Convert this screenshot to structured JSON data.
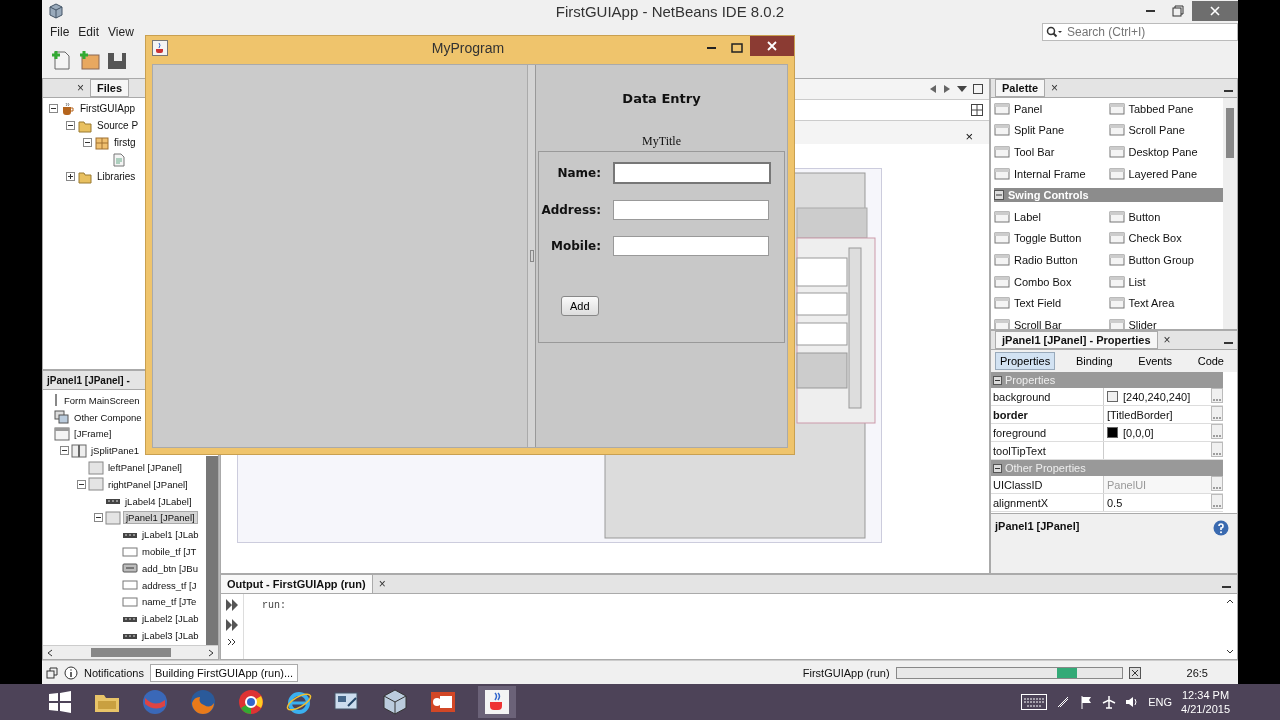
{
  "ide": {
    "title": "FirstGUIApp - NetBeans IDE 8.0.2",
    "menu": [
      "File",
      "Edit",
      "View"
    ],
    "search": {
      "placeholder": "Search (Ctrl+I)"
    }
  },
  "projects": {
    "close_mark": "×",
    "tabs": [
      {
        "label": "Files",
        "selected": true
      }
    ],
    "tree": [
      {
        "label": "FirstGUIApp",
        "kind": "project",
        "expanded": true,
        "selected": false,
        "children": [
          {
            "label": "Source P",
            "kind": "folder",
            "expanded": true,
            "selected": false,
            "children": [
              {
                "label": "firstg",
                "kind": "package",
                "expanded": true,
                "selected": false,
                "children": [
                  {
                    "kind": "file",
                    "selected": false
                  }
                ]
              }
            ]
          },
          {
            "label": "Libraries",
            "kind": "folder",
            "expanded": false,
            "selected": false
          }
        ]
      }
    ]
  },
  "navigator": {
    "title": "jPanel1 [JPanel] -",
    "tree": [
      {
        "label": "Form MainScreen",
        "kind": "form",
        "selected": false,
        "children": [
          {
            "label": "Other Compone",
            "kind": "other",
            "selected": false
          },
          {
            "label": "[JFrame]",
            "kind": "frame",
            "selected": false,
            "children": [
              {
                "label": "jSplitPane1",
                "kind": "split",
                "expanded": true,
                "selected": false,
                "children": [
                  {
                    "label": "leftPanel [JPanel]",
                    "kind": "panel",
                    "selected": false
                  },
                  {
                    "label": "rightPanel [JPanel]",
                    "kind": "panel",
                    "expanded": true,
                    "selected": false,
                    "children": [
                      {
                        "label": "jLabel4 [JLabel]",
                        "kind": "label",
                        "selected": false
                      },
                      {
                        "label": "jPanel1 [JPanel]",
                        "kind": "panel",
                        "expanded": true,
                        "selected": true,
                        "children": [
                          {
                            "label": "jLabel1 [JLab",
                            "kind": "label",
                            "selected": false
                          },
                          {
                            "label": "mobile_tf [JT",
                            "kind": "field",
                            "selected": false
                          },
                          {
                            "label": "add_btn [JBu",
                            "kind": "button",
                            "selected": false
                          },
                          {
                            "label": "address_tf [J",
                            "kind": "field",
                            "selected": false
                          },
                          {
                            "label": "name_tf [JTe",
                            "kind": "field",
                            "selected": false
                          },
                          {
                            "label": "jLabel2 [JLab",
                            "kind": "label",
                            "selected": false
                          },
                          {
                            "label": "jLabel3 [JLab",
                            "kind": "label",
                            "selected": false
                          }
                        ]
                      }
                    ]
                  }
                ]
              }
            ]
          }
        ]
      }
    ]
  },
  "editor": {
    "close_mark": "×"
  },
  "palette": {
    "title": "Palette",
    "close_mark": "×",
    "groups": [
      {
        "items": [
          "Panel",
          "Tabbed Pane",
          "Split Pane",
          "Scroll Pane",
          "Tool Bar",
          "Desktop Pane",
          "Internal Frame",
          "Layered Pane"
        ]
      },
      {
        "title": "Swing Controls",
        "expanded": true,
        "items": [
          "Label",
          "Button",
          "Toggle Button",
          "Check Box",
          "Radio Button",
          "Button Group",
          "Combo Box",
          "List",
          "Text Field",
          "Text Area",
          "Scroll Bar",
          "Slider"
        ]
      }
    ]
  },
  "properties": {
    "title": "jPanel1 [JPanel] - Properties",
    "close_mark": "×",
    "tabs": [
      {
        "label": "Properties",
        "selected": true
      },
      {
        "label": "Binding",
        "selected": false
      },
      {
        "label": "Events",
        "selected": false
      },
      {
        "label": "Code",
        "selected": false
      }
    ],
    "sections": [
      {
        "title": "Properties",
        "expanded": true,
        "rows": [
          {
            "name": "background",
            "value": "[240,240,240]",
            "color": "#f0f0f0",
            "modified": false,
            "read_only": false
          },
          {
            "name": "border",
            "value": "[TitledBorder]",
            "modified": true,
            "read_only": false
          },
          {
            "name": "foreground",
            "value": "[0,0,0]",
            "color": "#000000",
            "modified": false,
            "read_only": false
          },
          {
            "name": "toolTipText",
            "modified": false,
            "read_only": false
          }
        ]
      },
      {
        "title": "Other Properties",
        "expanded": true,
        "rows": [
          {
            "name": "UIClassID",
            "value": "PanelUI",
            "modified": false,
            "read_only": true
          },
          {
            "name": "alignmentX",
            "value": "0.5",
            "modified": false,
            "read_only": false
          }
        ]
      }
    ],
    "footer": "jPanel1 [JPanel]"
  },
  "output": {
    "tab": "Output - FirstGUIApp (run)",
    "close_mark": "×",
    "text": "run:"
  },
  "status_bar": {
    "notifications": "Notifications",
    "task": "Building FirstGUIApp (run)...",
    "process": "FirstGUIApp (run)",
    "position": "26:5"
  },
  "dialog": {
    "title": "MyProgram",
    "heading": "Data Entry",
    "group_title": "MyTitle",
    "fields": [
      {
        "label": "Name:",
        "focused": true
      },
      {
        "label": "Address:",
        "focused": false
      },
      {
        "label": "Mobile:",
        "focused": false
      }
    ],
    "button": "Add"
  },
  "taskbar": {
    "language": "ENG",
    "time": "12:34 PM",
    "date": "4/21/2015"
  }
}
